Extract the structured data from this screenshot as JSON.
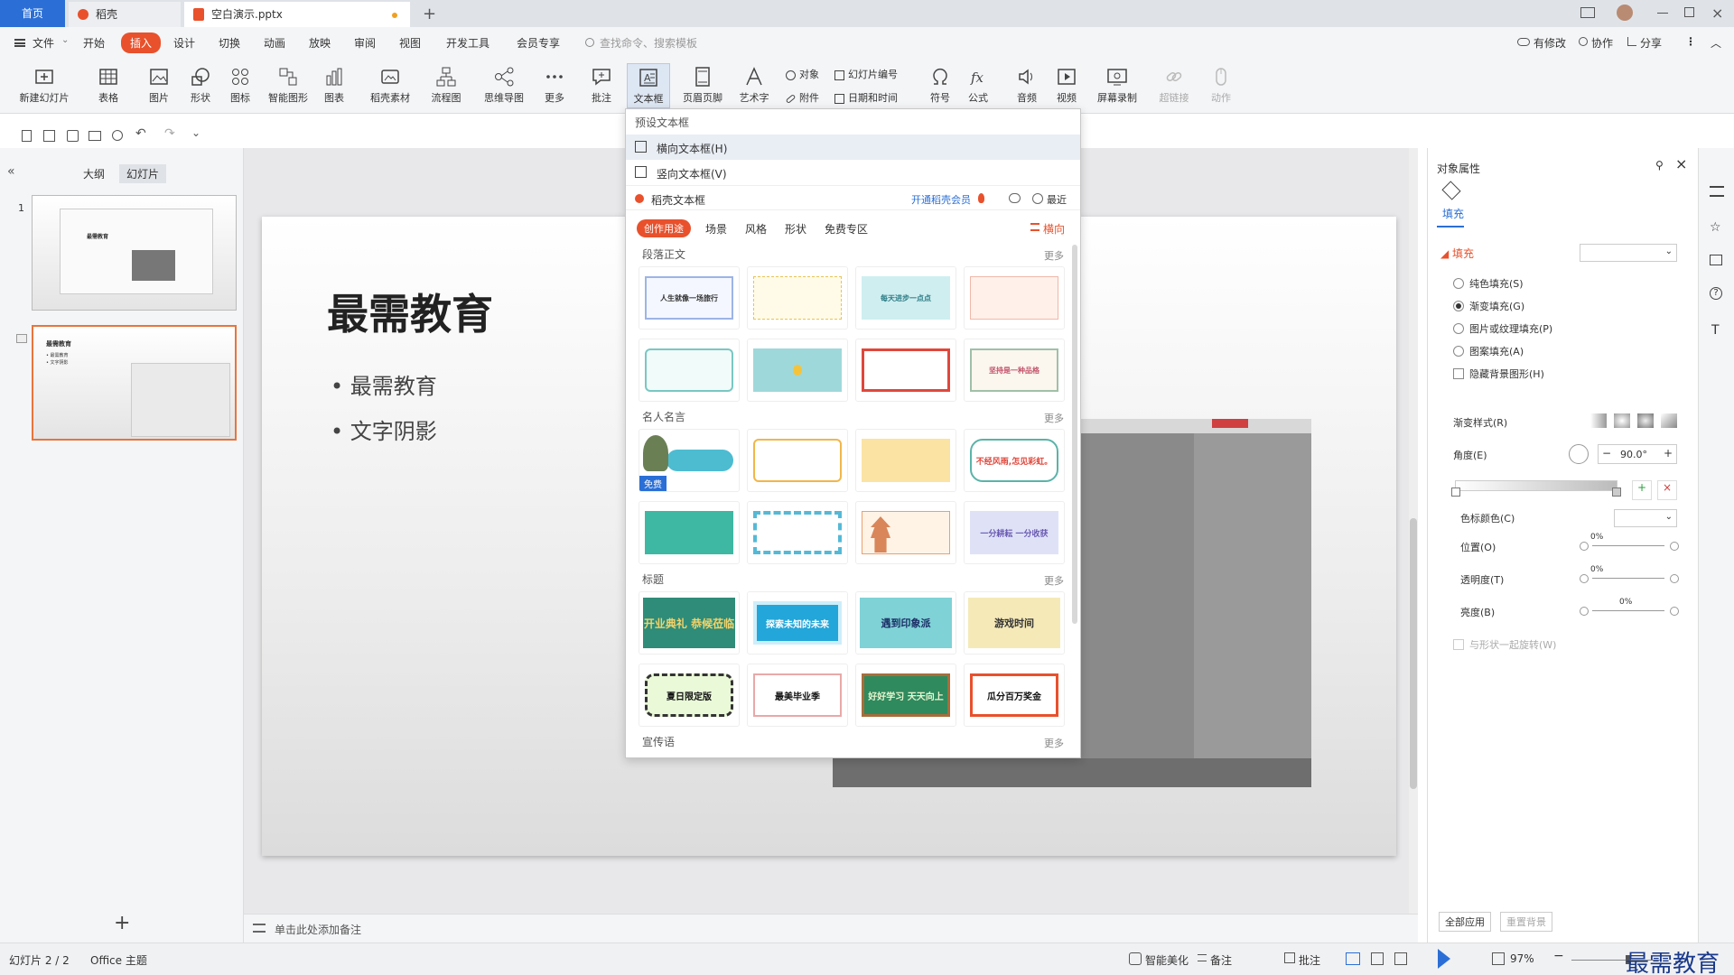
{
  "tabs": {
    "home": "首页",
    "daoke": "稻壳",
    "file": "空白演示.pptx",
    "add": "+"
  },
  "menu": {
    "file": "文件",
    "start": "开始",
    "insert": "插入",
    "design": "设计",
    "transition": "切换",
    "animation": "动画",
    "slideshow": "放映",
    "review": "审阅",
    "view": "视图",
    "devtools": "开发工具",
    "member": "会员专享",
    "search_placeholder": "查找命令、搜索模板",
    "edited": "有修改",
    "collab": "协作",
    "share": "分享"
  },
  "ribbon": {
    "new_slide": "新建幻灯片",
    "table": "表格",
    "picture": "图片",
    "shape": "形状",
    "icon": "图标",
    "smartart": "智能图形",
    "chart": "图表",
    "daoke_material": "稻壳素材",
    "flowchart": "流程图",
    "mindmap": "思维导图",
    "more": "更多",
    "comment": "批注",
    "textbox": "文本框",
    "header_footer": "页眉页脚",
    "wordart": "艺术字",
    "object": "对象",
    "attachment": "附件",
    "slide_number": "幻灯片编号",
    "datetime": "日期和时间",
    "symbol": "符号",
    "formula": "公式",
    "audio": "音频",
    "video": "视频",
    "screen_record": "屏幕录制",
    "hyperlink": "超链接",
    "action": "动作"
  },
  "leftpane": {
    "outline": "大纲",
    "slides": "幻灯片",
    "thumb1_num": "1",
    "thumb2_num": "2",
    "thumb1_title": "最需教育",
    "thumb2_title": "最需教育",
    "thumb2_b1": "• 最需教育",
    "thumb2_b2": "• 文字阴影"
  },
  "slide": {
    "title": "最需教育",
    "bullet1": "最需教育",
    "bullet2": "文字阴影"
  },
  "dropdown": {
    "preset": "预设文本框",
    "horizontal": "横向文本框(H)",
    "vertical": "竖向文本框(V)",
    "daoke_textbox": "稻壳文本框",
    "vip": "开通稻壳会员",
    "recent": "最近",
    "cats": [
      "创作用途",
      "场景",
      "风格",
      "形状",
      "免费专区"
    ],
    "orient": "横向",
    "sections": [
      "段落正文",
      "名人名言",
      "标题",
      "宣传语"
    ],
    "more": "更多",
    "free_badge": "免费",
    "quote_cards": [
      "",
      "",
      "",
      "不经风雨,怎见彩虹。",
      "",
      "",
      "",
      "一分耕耘 一分收获"
    ],
    "para_cards": [
      "人生就像一场旅行",
      "",
      "每天进步一点点",
      "",
      "",
      "",
      "",
      "坚持是一种品格"
    ],
    "title_cards": [
      "开业典礼 恭候莅临",
      "探索未知的未来",
      "遇到印象派",
      "游戏时间",
      "夏日限定版",
      "最美毕业季",
      "好好学习 天天向上",
      "瓜分百万奖金"
    ]
  },
  "notes": {
    "placeholder": "单击此处添加备注"
  },
  "rpanel": {
    "title": "对象属性",
    "fill_tab": "填充",
    "fill_section": "填充",
    "solid": "纯色填充(S)",
    "gradient": "渐变填充(G)",
    "picture_tex": "图片或纹理填充(P)",
    "pattern": "图案填充(A)",
    "hide_bg": "隐藏背景图形(H)",
    "grad_style": "渐变样式(R)",
    "angle": "角度(E)",
    "angle_val": "90.0°",
    "stop_color": "色标颜色(C)",
    "position": "位置(O)",
    "transparency": "透明度(T)",
    "brightness": "亮度(B)",
    "pct": "0%",
    "rotate_with": "与形状一起旋转(W)",
    "apply_all": "全部应用",
    "reset_bg": "重置背景"
  },
  "status": {
    "slide_info": "幻灯片 2 / 2",
    "theme": "Office 主题",
    "beautify": "智能美化",
    "notes": "备注",
    "comment": "批注",
    "zoom": "97%",
    "watermark": "最需教育"
  },
  "colors": {
    "accent": "#e8512c",
    "blue": "#2b6fd6",
    "tabbar": "#dfe3e8"
  }
}
